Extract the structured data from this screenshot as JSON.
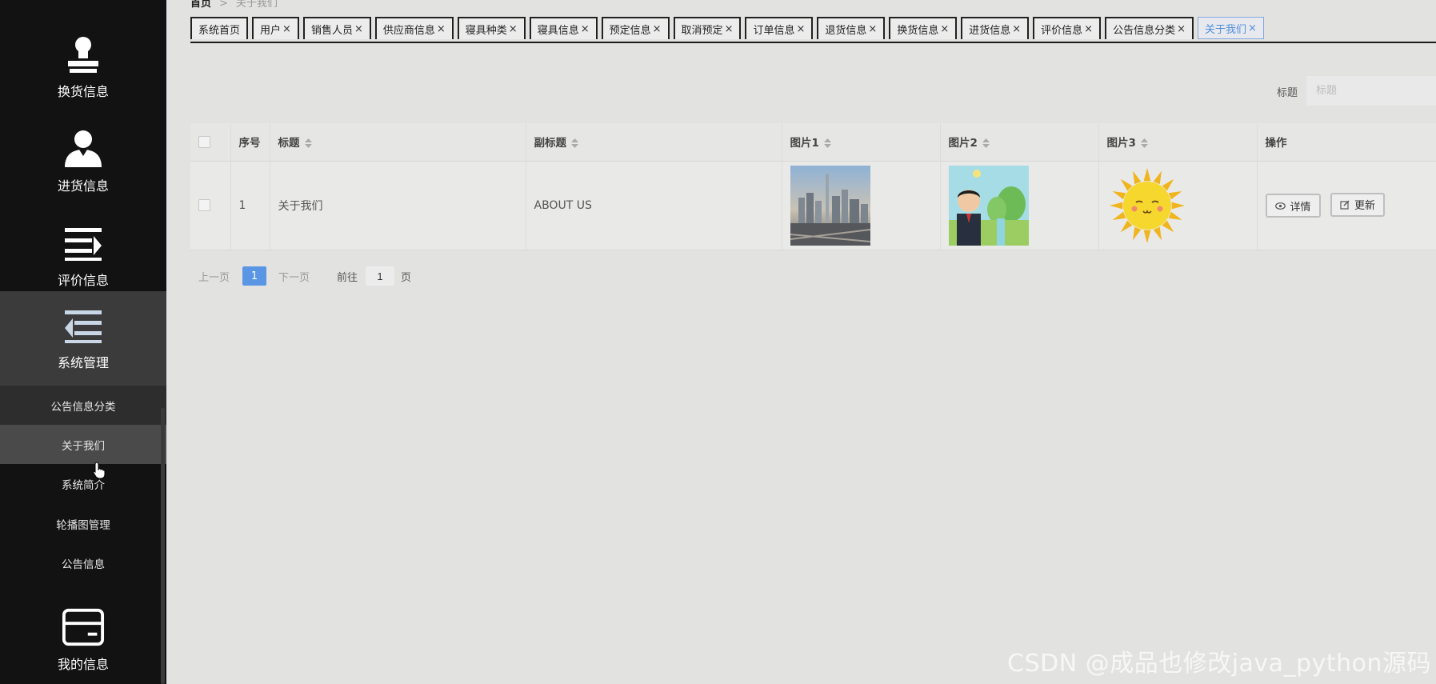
{
  "sidebar": {
    "items": [
      {
        "label": "换货信息",
        "icon": "stamp-icon"
      },
      {
        "label": "进货信息",
        "icon": "user-icon"
      },
      {
        "label": "评价信息",
        "icon": "list-arrow-right-icon"
      },
      {
        "label": "系统管理",
        "icon": "list-arrow-left-icon"
      },
      {
        "label": "我的信息",
        "icon": "card-icon"
      }
    ],
    "sub_items": [
      {
        "label": "公告信息分类"
      },
      {
        "label": "关于我们"
      },
      {
        "label": "系统简介"
      },
      {
        "label": "轮播图管理"
      },
      {
        "label": "公告信息"
      }
    ]
  },
  "breadcrumb": {
    "home": "首页",
    "sep": ">",
    "current": "关于我们"
  },
  "tabs": [
    {
      "label": "系统首页",
      "closable": false
    },
    {
      "label": "用户",
      "closable": true
    },
    {
      "label": "销售人员",
      "closable": true
    },
    {
      "label": "供应商信息",
      "closable": true
    },
    {
      "label": "寝具种类",
      "closable": true
    },
    {
      "label": "寝具信息",
      "closable": true
    },
    {
      "label": "预定信息",
      "closable": true
    },
    {
      "label": "取消预定",
      "closable": true
    },
    {
      "label": "订单信息",
      "closable": true
    },
    {
      "label": "退货信息",
      "closable": true
    },
    {
      "label": "换货信息",
      "closable": true
    },
    {
      "label": "进货信息",
      "closable": true
    },
    {
      "label": "评价信息",
      "closable": true
    },
    {
      "label": "公告信息分类",
      "closable": true
    },
    {
      "label": "关于我们",
      "closable": true,
      "active": true
    }
  ],
  "tab_close_glyph": "×",
  "search": {
    "label": "标题",
    "placeholder": "标题",
    "value": ""
  },
  "table": {
    "headers": [
      "序号",
      "标题",
      "副标题",
      "图片1",
      "图片2",
      "图片3",
      "操作"
    ],
    "rows": [
      {
        "index": "1",
        "title": "关于我们",
        "subtitle": "ABOUT US",
        "img1": "city-skyline-photo",
        "img2": "cartoon-person-park-image",
        "img3": "smiling-sun-cartoon-image"
      }
    ],
    "actions": {
      "detail": "详情",
      "update": "更新"
    }
  },
  "pager": {
    "prev": "上一页",
    "current": "1",
    "next": "下一页",
    "goto": "前往",
    "goto_value": "1",
    "unit": "页"
  },
  "watermark": "CSDN @成品也修改java_python源码",
  "colors": {
    "accent": "#5a96e4",
    "sidebar_bg": "#121212",
    "active_tab": "#4f8ede"
  }
}
